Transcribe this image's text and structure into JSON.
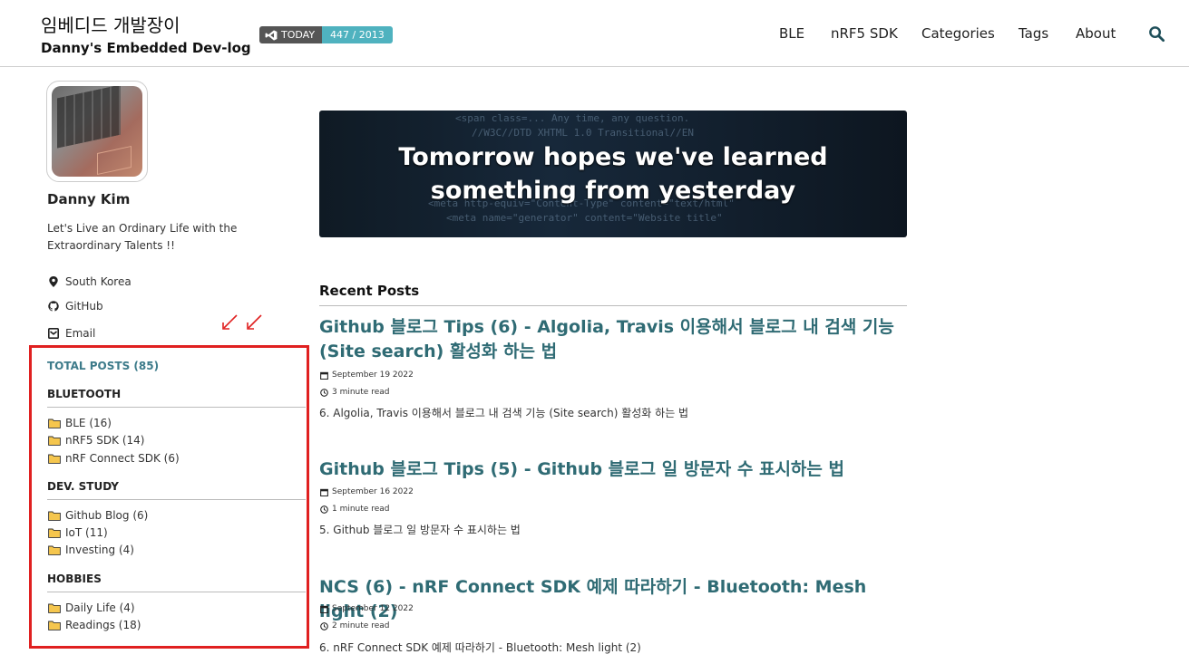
{
  "header": {
    "title_kr": "임베디드 개발장이",
    "title_en": "Danny's Embedded Dev-log",
    "hits": {
      "label": "TODAY",
      "value": "447 / 2013"
    },
    "nav": [
      "BLE",
      "nRF5 SDK",
      "Categories",
      "Tags",
      "About"
    ]
  },
  "author": {
    "name": "Danny Kim",
    "bio": "Let's Live an Ordinary Life with the Extraordinary Talents !!",
    "location": "South Korea",
    "github": "GitHub",
    "email": "Email"
  },
  "toc": {
    "total": "TOTAL POSTS (85)",
    "groups": [
      {
        "heading": "BLUETOOTH",
        "items": [
          "BLE (16)",
          "nRF5 SDK (14)",
          "nRF Connect SDK (6)"
        ]
      },
      {
        "heading": "DEV. STUDY",
        "items": [
          "Github Blog (6)",
          "IoT (11)",
          "Investing (4)"
        ]
      },
      {
        "heading": "HOBBIES",
        "items": [
          "Daily Life (4)",
          "Readings (18)"
        ]
      }
    ]
  },
  "banner": {
    "line1": "Tomorrow hopes we've learned",
    "line2": "something from yesterday"
  },
  "recent": {
    "title": "Recent Posts",
    "posts": [
      {
        "title": "Github 블로그 Tips (6) - Algolia, Travis 이용해서 블로그 내 검색 기능 (Site search) 활성화 하는 법",
        "date": "September 19 2022",
        "read": "3 minute read",
        "excerpt": "6. Algolia, Travis 이용해서 블로그 내 검색 기능 (Site search) 활성화 하는 법"
      },
      {
        "title": "Github 블로그 Tips (5) - Github 블로그 일 방문자 수 표시하는 법",
        "date": "September 16 2022",
        "read": "1 minute read",
        "excerpt": "5. Github 블로그 일 방문자 수 표시하는 법"
      },
      {
        "title": "NCS (6) - nRF Connect SDK 예제 따라하기 - Bluetooth: Mesh light (2)",
        "date": "September 12 2022",
        "read": "2 minute read",
        "excerpt": "6. nRF Connect SDK 예제 따라하기 - Bluetooth: Mesh light (2)"
      }
    ]
  },
  "colors": {
    "accent": "#2f6b74",
    "highlight": "#e02020",
    "hits_badge": "#4fb2bf"
  }
}
